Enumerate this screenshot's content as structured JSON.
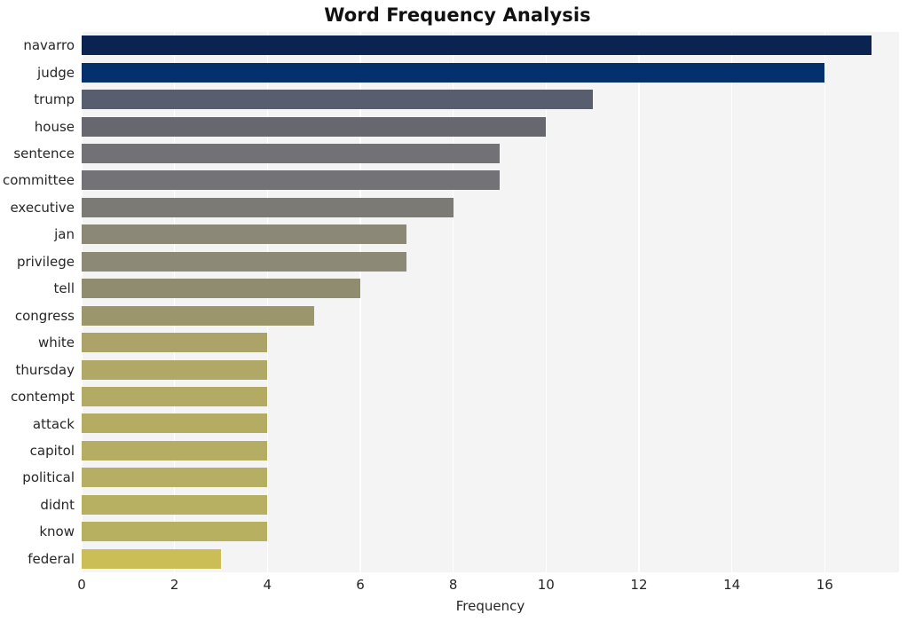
{
  "chart_data": {
    "type": "bar",
    "orientation": "horizontal",
    "title": "Word Frequency Analysis",
    "xlabel": "Frequency",
    "ylabel": "",
    "categories": [
      "navarro",
      "judge",
      "trump",
      "house",
      "sentence",
      "committee",
      "executive",
      "jan",
      "privilege",
      "tell",
      "congress",
      "white",
      "thursday",
      "contempt",
      "attack",
      "capitol",
      "political",
      "didnt",
      "know",
      "federal"
    ],
    "values": [
      17,
      16,
      11,
      10,
      9,
      9,
      8,
      7,
      7,
      6,
      5,
      4,
      4,
      4,
      4,
      4,
      4,
      4,
      4,
      3
    ],
    "bar_colors": [
      "#0a2350",
      "#05306e",
      "#585e6e",
      "#67676f",
      "#727276",
      "#737377",
      "#7b7a74",
      "#8b8877",
      "#8c8a76",
      "#8f8c6f",
      "#9c966c",
      "#aba368",
      "#b0a866",
      "#b3aa64",
      "#b4ac63",
      "#b5ad63",
      "#b6ae62",
      "#b7af62",
      "#b7b061",
      "#cbbe56"
    ],
    "xlim": [
      0,
      17.6
    ],
    "xticks": [
      0,
      2,
      4,
      6,
      8,
      10,
      12,
      14,
      16
    ],
    "xticklabels": [
      "0",
      "2",
      "4",
      "6",
      "8",
      "10",
      "12",
      "14",
      "16"
    ],
    "grid": "vertical-white-on-light-gray",
    "legend": "none",
    "style": "whitegrid",
    "colors": {
      "figure_background": "#ffffff",
      "axes_background": "#f4f4f5",
      "gridline": "#ffffff",
      "text": "#262626",
      "title": "#111111"
    }
  }
}
